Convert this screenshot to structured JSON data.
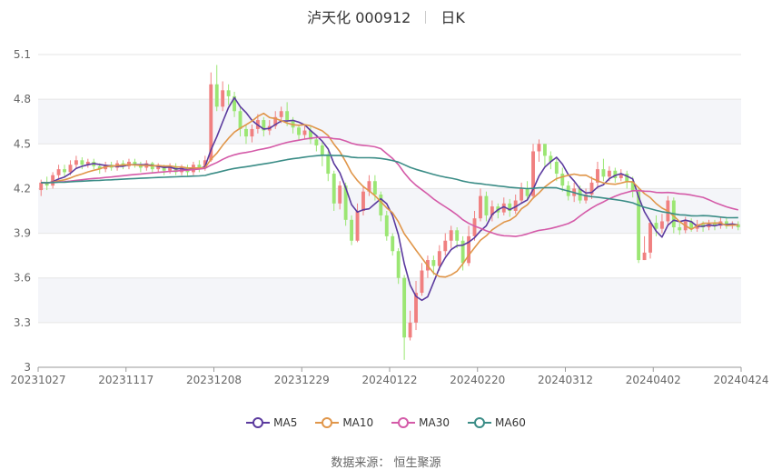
{
  "header": {
    "stock_name": "泸天化 000912",
    "period": "日K"
  },
  "source_label": "数据来源：  恒生聚源",
  "colors": {
    "up": "#f08080",
    "down": "#9be673",
    "MA5": "#5b3a9e",
    "MA10": "#e0964a",
    "MA30": "#d45aa8",
    "MA60": "#3a8c86"
  },
  "chart_data": {
    "type": "candlestick",
    "x_ticks": [
      "20231027",
      "20231117",
      "20231208",
      "20231229",
      "20240122",
      "20240220",
      "20240312",
      "20240402",
      "20240424"
    ],
    "y_ticks": [
      "5.1",
      "4.8",
      "4.5",
      "4.2",
      "3.9",
      "3.6",
      "3.3",
      "3"
    ],
    "ylim": [
      3.0,
      5.1
    ],
    "legend": [
      "MA5",
      "MA10",
      "MA30",
      "MA60"
    ],
    "trading_days": 120,
    "candles": [
      [
        4.19,
        4.24,
        4.15,
        4.26
      ],
      [
        4.24,
        4.22,
        4.19,
        4.28
      ],
      [
        4.22,
        4.29,
        4.2,
        4.31
      ],
      [
        4.29,
        4.33,
        4.27,
        4.36
      ],
      [
        4.33,
        4.31,
        4.28,
        4.36
      ],
      [
        4.31,
        4.36,
        4.29,
        4.39
      ],
      [
        4.36,
        4.39,
        4.34,
        4.42
      ],
      [
        4.39,
        4.36,
        4.33,
        4.41
      ],
      [
        4.36,
        4.38,
        4.34,
        4.4
      ],
      [
        4.38,
        4.35,
        4.33,
        4.4
      ],
      [
        4.35,
        4.33,
        4.3,
        4.37
      ],
      [
        4.33,
        4.36,
        4.31,
        4.38
      ],
      [
        4.36,
        4.34,
        4.32,
        4.38
      ],
      [
        4.34,
        4.37,
        4.32,
        4.39
      ],
      [
        4.37,
        4.35,
        4.33,
        4.39
      ],
      [
        4.35,
        4.38,
        4.33,
        4.4
      ],
      [
        4.38,
        4.36,
        4.34,
        4.4
      ],
      [
        4.36,
        4.34,
        4.31,
        4.38
      ],
      [
        4.34,
        4.37,
        4.32,
        4.39
      ],
      [
        4.37,
        4.33,
        4.3,
        4.38
      ],
      [
        4.33,
        4.35,
        4.31,
        4.37
      ],
      [
        4.35,
        4.32,
        4.29,
        4.36
      ],
      [
        4.32,
        4.35,
        4.3,
        4.37
      ],
      [
        4.35,
        4.31,
        4.29,
        4.37
      ],
      [
        4.31,
        4.34,
        4.29,
        4.36
      ],
      [
        4.34,
        4.31,
        4.28,
        4.36
      ],
      [
        4.31,
        4.36,
        4.29,
        4.38
      ],
      [
        4.36,
        4.34,
        4.31,
        4.39
      ],
      [
        4.34,
        4.39,
        4.32,
        4.42
      ],
      [
        4.39,
        4.9,
        4.38,
        4.98
      ],
      [
        4.9,
        4.75,
        4.72,
        5.03
      ],
      [
        4.75,
        4.86,
        4.72,
        4.92
      ],
      [
        4.86,
        4.82,
        4.76,
        4.9
      ],
      [
        4.82,
        4.72,
        4.68,
        4.85
      ],
      [
        4.72,
        4.6,
        4.55,
        4.75
      ],
      [
        4.6,
        4.55,
        4.5,
        4.63
      ],
      [
        4.55,
        4.6,
        4.51,
        4.63
      ],
      [
        4.6,
        4.66,
        4.57,
        4.7
      ],
      [
        4.66,
        4.59,
        4.55,
        4.68
      ],
      [
        4.59,
        4.62,
        4.56,
        4.66
      ],
      [
        4.62,
        4.68,
        4.6,
        4.72
      ],
      [
        4.68,
        4.72,
        4.64,
        4.75
      ],
      [
        4.72,
        4.66,
        4.62,
        4.78
      ],
      [
        4.66,
        4.61,
        4.57,
        4.68
      ],
      [
        4.61,
        4.56,
        4.52,
        4.63
      ],
      [
        4.56,
        4.59,
        4.53,
        4.62
      ],
      [
        4.59,
        4.53,
        4.5,
        4.62
      ],
      [
        4.53,
        4.49,
        4.45,
        4.55
      ],
      [
        4.49,
        4.42,
        4.35,
        4.52
      ],
      [
        4.42,
        4.3,
        4.25,
        4.45
      ],
      [
        4.3,
        4.1,
        4.05,
        4.32
      ],
      [
        4.1,
        4.22,
        4.06,
        4.25
      ],
      [
        4.22,
        3.99,
        3.95,
        4.24
      ],
      [
        3.99,
        3.85,
        3.82,
        4.02
      ],
      [
        3.85,
        4.05,
        3.84,
        4.1
      ],
      [
        4.05,
        4.18,
        4.02,
        4.22
      ],
      [
        4.18,
        4.25,
        4.15,
        4.29
      ],
      [
        4.25,
        4.16,
        4.12,
        4.29
      ],
      [
        4.16,
        4.02,
        3.98,
        4.18
      ],
      [
        4.02,
        3.88,
        3.85,
        4.05
      ],
      [
        3.88,
        3.78,
        3.75,
        3.9
      ],
      [
        3.78,
        3.6,
        3.56,
        3.8
      ],
      [
        3.6,
        3.2,
        3.05,
        3.62
      ],
      [
        3.2,
        3.3,
        3.18,
        3.38
      ],
      [
        3.3,
        3.5,
        3.25,
        3.58
      ],
      [
        3.5,
        3.65,
        3.48,
        3.7
      ],
      [
        3.65,
        3.72,
        3.6,
        3.75
      ],
      [
        3.72,
        3.68,
        3.62,
        3.75
      ],
      [
        3.68,
        3.78,
        3.65,
        3.82
      ],
      [
        3.78,
        3.85,
        3.75,
        3.9
      ],
      [
        3.85,
        3.92,
        3.8,
        3.95
      ],
      [
        3.92,
        3.85,
        3.8,
        3.94
      ],
      [
        3.85,
        3.7,
        3.65,
        3.88
      ],
      [
        3.7,
        3.88,
        3.68,
        3.95
      ],
      [
        3.88,
        4.0,
        3.85,
        4.05
      ],
      [
        4.0,
        4.15,
        3.98,
        4.2
      ],
      [
        4.15,
        4.02,
        3.98,
        4.18
      ],
      [
        4.02,
        4.08,
        3.98,
        4.12
      ],
      [
        4.08,
        4.04,
        4.0,
        4.1
      ],
      [
        4.04,
        4.1,
        4.02,
        4.14
      ],
      [
        4.1,
        4.05,
        4.01,
        4.13
      ],
      [
        4.05,
        4.12,
        4.03,
        4.16
      ],
      [
        4.12,
        4.2,
        4.1,
        4.24
      ],
      [
        4.2,
        4.15,
        4.12,
        4.25
      ],
      [
        4.15,
        4.45,
        4.13,
        4.5
      ],
      [
        4.45,
        4.5,
        4.38,
        4.53
      ],
      [
        4.5,
        4.42,
        4.35,
        4.5
      ],
      [
        4.42,
        4.38,
        4.33,
        4.45
      ],
      [
        4.38,
        4.3,
        4.25,
        4.4
      ],
      [
        4.3,
        4.22,
        4.18,
        4.34
      ],
      [
        4.22,
        4.15,
        4.12,
        4.25
      ],
      [
        4.15,
        4.2,
        4.11,
        4.24
      ],
      [
        4.2,
        4.12,
        4.1,
        4.22
      ],
      [
        4.12,
        4.16,
        4.1,
        4.2
      ],
      [
        4.16,
        4.24,
        4.13,
        4.28
      ],
      [
        4.24,
        4.33,
        4.2,
        4.38
      ],
      [
        4.33,
        4.28,
        4.25,
        4.4
      ],
      [
        4.28,
        4.32,
        4.25,
        4.35
      ],
      [
        4.32,
        4.27,
        4.24,
        4.34
      ],
      [
        4.27,
        4.3,
        4.25,
        4.33
      ],
      [
        4.3,
        4.25,
        4.2,
        4.32
      ],
      [
        4.25,
        4.18,
        4.14,
        4.28
      ],
      [
        4.18,
        3.72,
        3.7,
        4.2
      ],
      [
        3.72,
        3.77,
        3.72,
        3.88
      ],
      [
        3.77,
        3.97,
        3.73,
        3.99
      ],
      [
        3.97,
        3.93,
        3.88,
        4.02
      ],
      [
        3.93,
        3.98,
        3.9,
        4.03
      ],
      [
        3.98,
        4.12,
        3.95,
        4.15
      ],
      [
        4.12,
        3.94,
        3.9,
        4.14
      ],
      [
        3.94,
        3.92,
        3.89,
        3.97
      ],
      [
        3.92,
        3.98,
        3.9,
        4.01
      ],
      [
        3.98,
        3.93,
        3.91,
        4.0
      ],
      [
        3.93,
        3.96,
        3.91,
        3.99
      ],
      [
        3.96,
        3.94,
        3.91,
        3.98
      ],
      [
        3.94,
        3.97,
        3.92,
        3.99
      ],
      [
        3.97,
        3.95,
        3.92,
        3.99
      ],
      [
        3.95,
        3.98,
        3.93,
        4.01
      ],
      [
        3.98,
        3.95,
        3.93,
        4.0
      ],
      [
        3.95,
        3.96,
        3.93,
        3.98
      ],
      [
        3.96,
        3.94,
        3.92,
        3.98
      ]
    ]
  }
}
